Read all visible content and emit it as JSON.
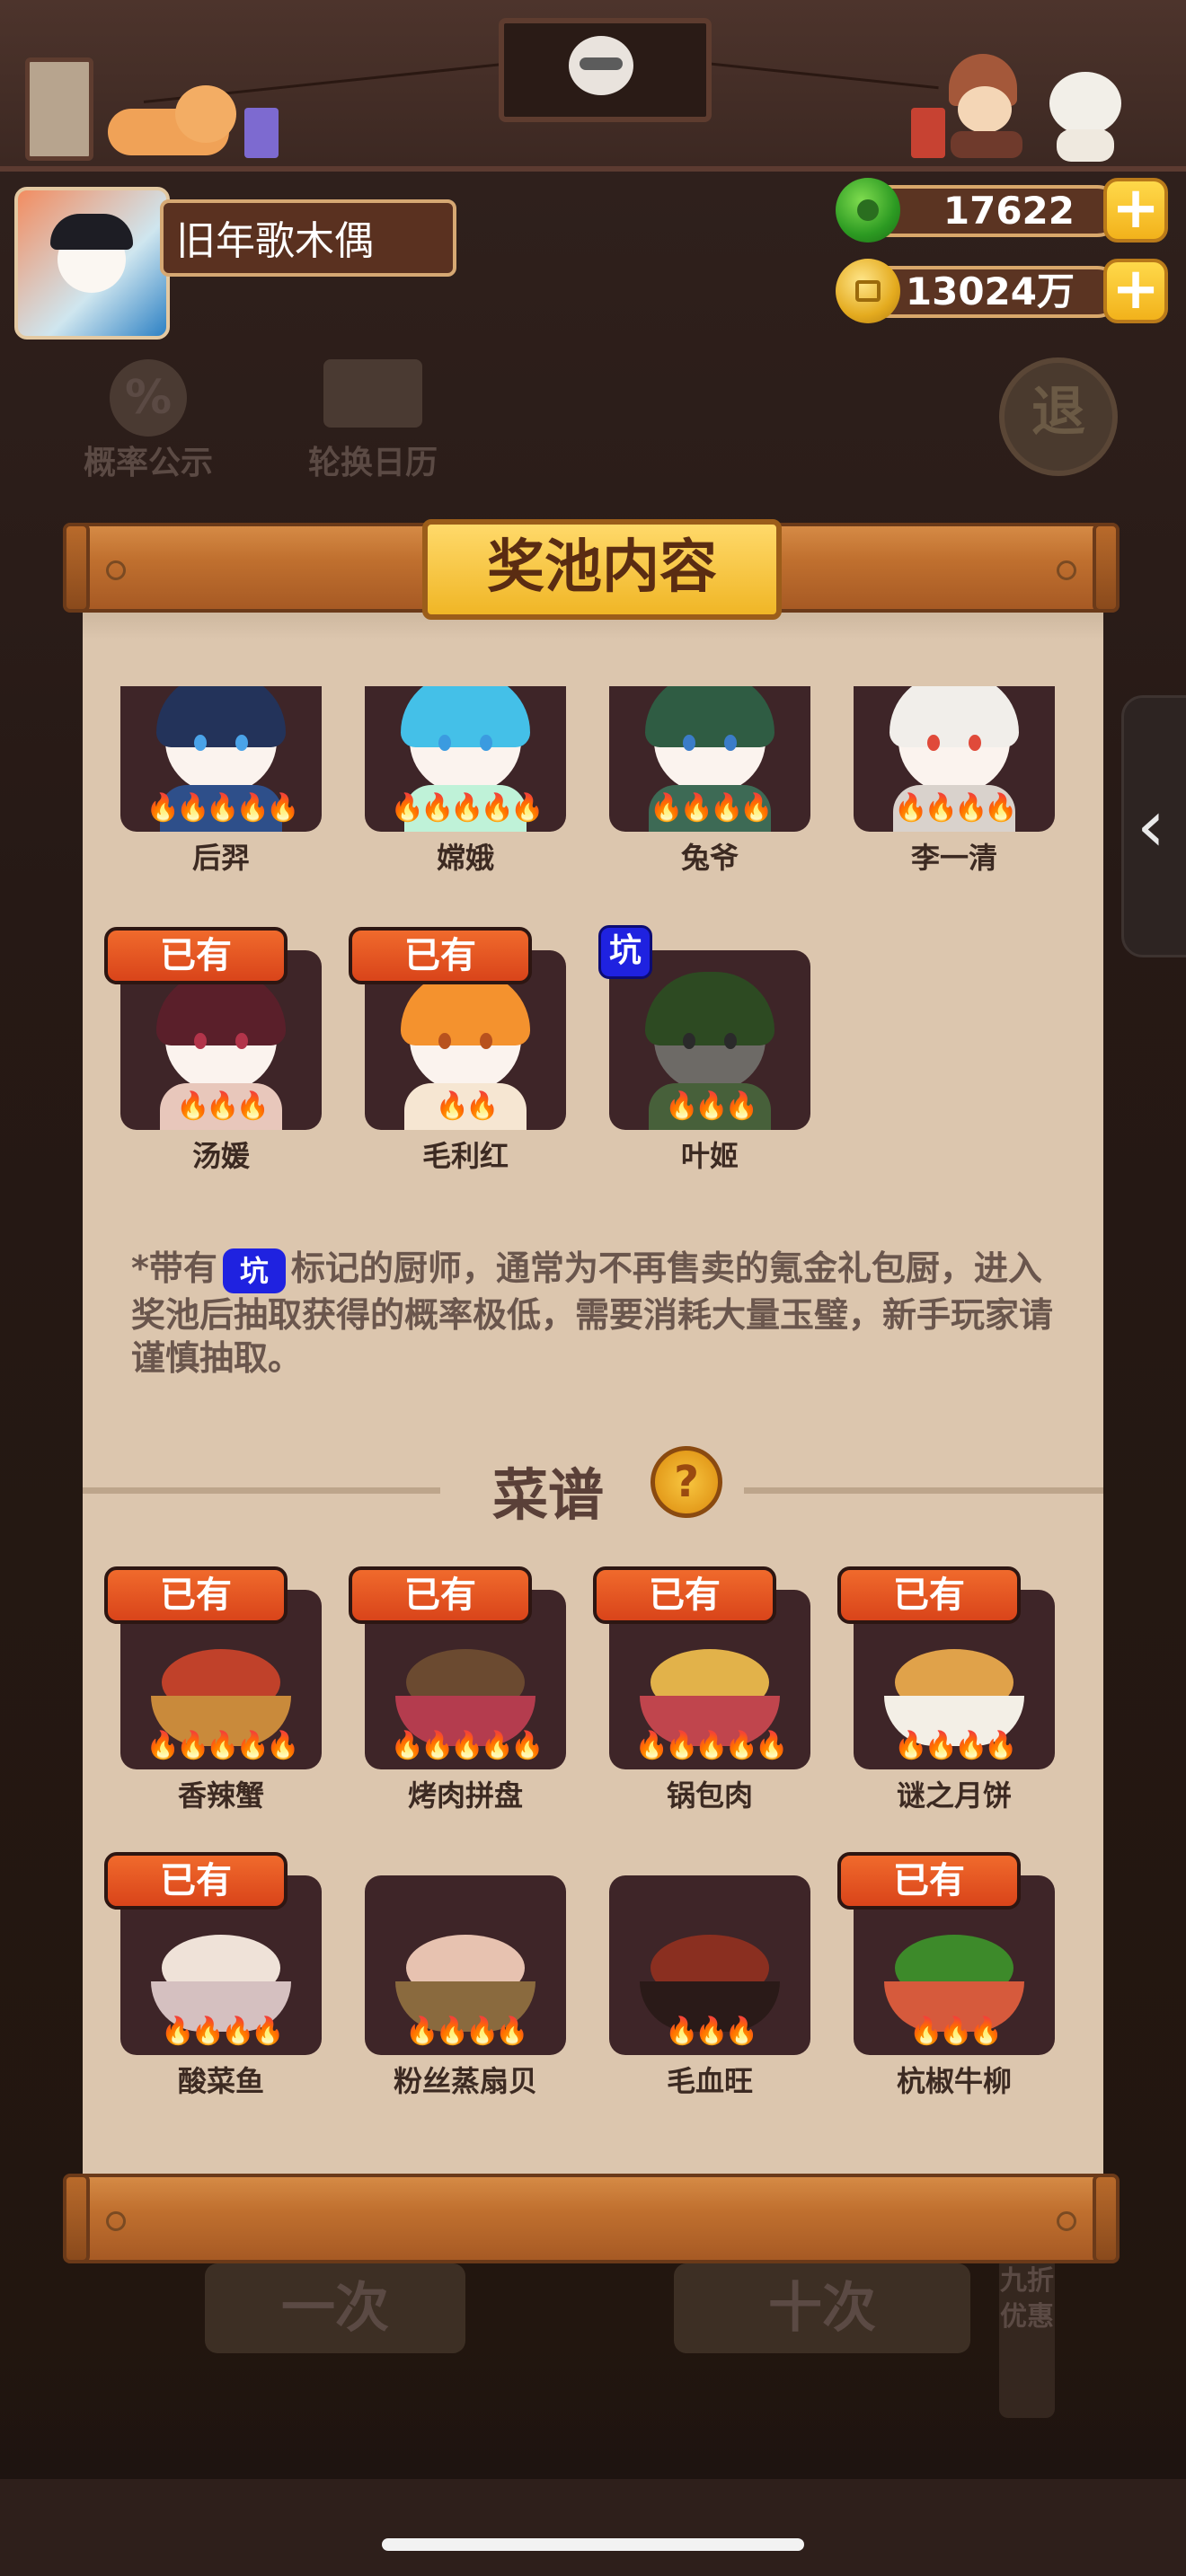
{
  "player": {
    "name": "旧年歌木偶"
  },
  "currency": [
    {
      "icon": "jade-icon",
      "value": "17622"
    },
    {
      "icon": "coin-icon",
      "value": "13024万"
    }
  ],
  "background": {
    "prob_label": "概率公示",
    "prob_glyph": "%",
    "rotate_label": "轮换日历",
    "exit_glyph": "退",
    "single_draw": "一次",
    "ten_draw": "十次",
    "discount": "九折优惠"
  },
  "panel": {
    "title": "奖池内容",
    "chefs": [
      {
        "name": "后羿",
        "owned": false,
        "rare": false,
        "flames": 5
      },
      {
        "name": "嫦娥",
        "owned": false,
        "rare": false,
        "flames": 5
      },
      {
        "name": "兔爷",
        "owned": false,
        "rare": false,
        "flames": 4
      },
      {
        "name": "李一清",
        "owned": false,
        "rare": false,
        "flames": 4
      },
      {
        "name": "汤媛",
        "owned": true,
        "rare": false,
        "flames": 3
      },
      {
        "name": "毛利红",
        "owned": true,
        "rare": false,
        "flames": 2
      },
      {
        "name": "叶姬",
        "owned": false,
        "rare": true,
        "flames": 3
      }
    ],
    "owned_label": "已有",
    "rare_label": "坑",
    "note_prefix": "*带有",
    "note_suffix": "标记的厨师，通常为不再售卖的氪金礼包厨，进入奖池后抽取获得的概率极低，需要消耗大量玉璧，新手玩家请谨慎抽取。",
    "recipe_title": "菜谱",
    "help_glyph": "?",
    "recipes": [
      {
        "name": "香辣蟹",
        "owned": true,
        "flames": 5
      },
      {
        "name": "烤肉拼盘",
        "owned": true,
        "flames": 5
      },
      {
        "name": "锅包肉",
        "owned": true,
        "flames": 5
      },
      {
        "name": "谜之月饼",
        "owned": true,
        "flames": 4
      },
      {
        "name": "酸菜鱼",
        "owned": true,
        "flames": 4
      },
      {
        "name": "粉丝蒸扇贝",
        "owned": false,
        "flames": 4
      },
      {
        "name": "毛血旺",
        "owned": false,
        "flames": 3
      },
      {
        "name": "杭椒牛柳",
        "owned": true,
        "flames": 3
      }
    ]
  },
  "colors": {
    "owned_badge": "#e85424",
    "rare_badge": "#1f22e0",
    "panel": "#dcc6ae",
    "tile": "#3e2528"
  }
}
